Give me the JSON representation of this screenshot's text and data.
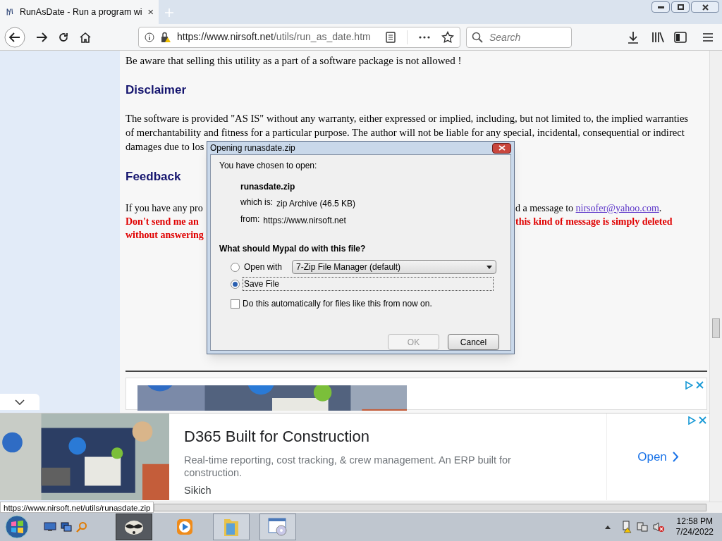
{
  "browser": {
    "tab": {
      "title": "RunAsDate - Run a program wi",
      "selected": true
    },
    "url": {
      "host": "https://www.nirsoft.net",
      "path": "/utils/run_as_date.htm"
    },
    "search": {
      "placeholder": "Search"
    }
  },
  "page": {
    "notice": "Be aware that selling this utility as a part of a software package is not allowed !",
    "disclaimer": {
      "heading": "Disclaimer",
      "lines": [
        "The software is provided \"AS IS\" without any warranty, either expressed or implied, including, but not limited to, the implied warranties",
        "of merchantability and fitness for a particular purpose. The author will not be liable for any special, incidental, consequential or indirect",
        "damages due to los"
      ]
    },
    "feedback": {
      "heading": "Feedback",
      "lines": [
        {
          "left": "If you have any pro",
          "right": "d a message to ",
          "link": "nirsofer@yahoo.com",
          "after": ".",
          "alert": false
        },
        {
          "left": "Don't send me an",
          "right": "this kind of message is simply deleted",
          "alert": true
        },
        {
          "left": "without answering",
          "alert": true
        }
      ]
    }
  },
  "dialog": {
    "title": "Opening runasdate.zip",
    "intro": "You have chosen to open:",
    "filename": "runasdate.zip",
    "details": [
      {
        "label": "which is:",
        "value": "zip Archive (46.5 KB)"
      },
      {
        "label": "from:",
        "value": "https://www.nirsoft.net"
      }
    ],
    "question": "What should Mypal do with this file?",
    "options": [
      {
        "kind": "dropdown",
        "label": "Open with",
        "selected": false,
        "value": "7-Zip File Manager (default)"
      },
      {
        "kind": "plain",
        "label": "Save File",
        "selected": true
      }
    ],
    "remember": {
      "label": "Do this automatically for files like this from now on.",
      "checked": false
    },
    "buttons": [
      {
        "label": "OK",
        "disabled": true
      },
      {
        "label": "Cancel",
        "disabled": false
      }
    ]
  },
  "ad": {
    "headline": "D365 Built for Construction",
    "description": "Real-time reporting, cost tracking, & crew management. An ERP built for construction.",
    "advertiser": "Sikich",
    "cta": "Open"
  },
  "status_url": "https://www.nirsoft.net/utils/runasdate.zip",
  "taskbar": {
    "time": "12:58 PM",
    "date": "7/24/2022"
  }
}
